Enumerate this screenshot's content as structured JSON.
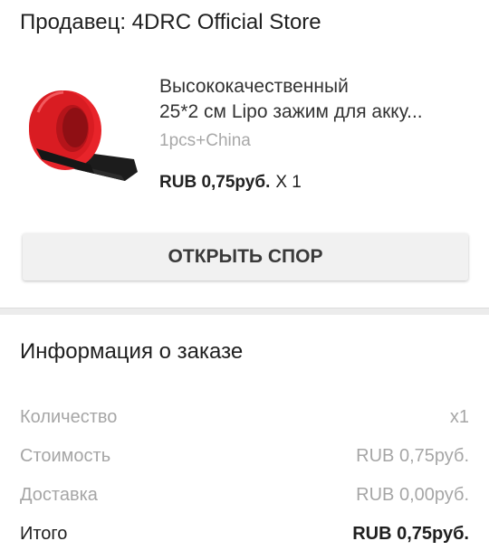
{
  "seller": {
    "label": "Продавец: 4DRC Official Store"
  },
  "product": {
    "title_line1": "Высококачественный",
    "title_line2": "25*2 см Lipo зажим для акку...",
    "variant": "1pcs+China",
    "price": "RUB 0,75руб.",
    "quantity": "X 1",
    "image_icon": "red-velcro-strap-image"
  },
  "actions": {
    "open_dispute": "ОТКРЫТЬ СПОР"
  },
  "order_info": {
    "title": "Информация о заказе",
    "rows": [
      {
        "label": "Количество",
        "value": "x1"
      },
      {
        "label": "Стоимость",
        "value": "RUB 0,75руб."
      },
      {
        "label": "Доставка",
        "value": "RUB 0,00руб."
      },
      {
        "label": "Итого",
        "value": "RUB 0,75руб."
      }
    ]
  },
  "colors": {
    "strap_red": "#e02025",
    "strap_black": "#1a1a1a",
    "muted_text": "#a6a6a6"
  }
}
